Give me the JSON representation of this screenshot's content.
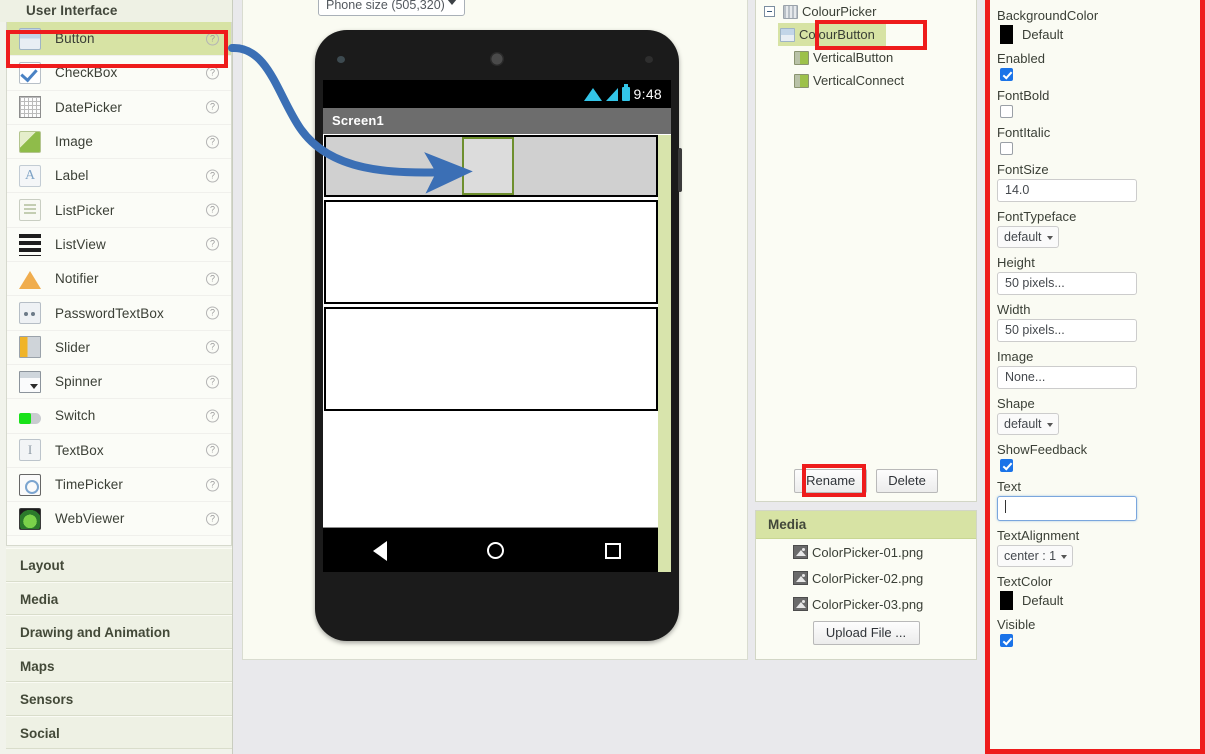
{
  "palette": {
    "header": "User Interface",
    "items": [
      {
        "label": "Button",
        "icon": "button-icon",
        "selected": true,
        "help": "?"
      },
      {
        "label": "CheckBox",
        "icon": "checkbox-icon",
        "selected": false,
        "help": "?"
      },
      {
        "label": "DatePicker",
        "icon": "datepicker-icon",
        "selected": false,
        "help": "?"
      },
      {
        "label": "Image",
        "icon": "image-icon",
        "selected": false,
        "help": "?"
      },
      {
        "label": "Label",
        "icon": "label-icon",
        "selected": false,
        "help": "?"
      },
      {
        "label": "ListPicker",
        "icon": "listpicker-icon",
        "selected": false,
        "help": "?"
      },
      {
        "label": "ListView",
        "icon": "listview-icon",
        "selected": false,
        "help": "?"
      },
      {
        "label": "Notifier",
        "icon": "notifier-icon",
        "selected": false,
        "help": "?"
      },
      {
        "label": "PasswordTextBox",
        "icon": "password-icon",
        "selected": false,
        "help": "?"
      },
      {
        "label": "Slider",
        "icon": "slider-icon",
        "selected": false,
        "help": "?"
      },
      {
        "label": "Spinner",
        "icon": "spinner-icon",
        "selected": false,
        "help": "?"
      },
      {
        "label": "Switch",
        "icon": "switch-icon",
        "selected": false,
        "help": "?"
      },
      {
        "label": "TextBox",
        "icon": "textbox-icon",
        "selected": false,
        "help": "?"
      },
      {
        "label": "TimePicker",
        "icon": "timepicker-icon",
        "selected": false,
        "help": "?"
      },
      {
        "label": "WebViewer",
        "icon": "webviewer-icon",
        "selected": false,
        "help": "?"
      }
    ],
    "categories": [
      "Layout",
      "Media",
      "Drawing and Animation",
      "Maps",
      "Sensors",
      "Social"
    ]
  },
  "viewer": {
    "phone_size_label": "Phone size (505,320)",
    "status_bar_time": "9:48",
    "screen_title": "Screen1",
    "nav_back_icon": "triangle-back-icon",
    "nav_home_icon": "circle-home-icon",
    "nav_recent_icon": "square-recent-icon"
  },
  "components": {
    "tree": [
      {
        "label": "ColourPicker",
        "icon": "screen-icon",
        "indent": 0,
        "selected": false,
        "toggle": true
      },
      {
        "label": "ColourButton",
        "icon": "button-icon",
        "indent": 1,
        "selected": true,
        "toggle": false
      },
      {
        "label": "VerticalButton",
        "icon": "vertical-arrangement-icon",
        "indent": 1,
        "selected": false,
        "toggle": false
      },
      {
        "label": "VerticalConnect",
        "icon": "vertical-arrangement-icon",
        "indent": 1,
        "selected": false,
        "toggle": false
      }
    ],
    "rename_label": "Rename",
    "delete_label": "Delete"
  },
  "media": {
    "header": "Media",
    "files": [
      "ColorPicker-01.png",
      "ColorPicker-02.png",
      "ColorPicker-03.png"
    ],
    "upload_label": "Upload File ..."
  },
  "properties": [
    {
      "name": "BackgroundColor",
      "type": "color",
      "value": "Default",
      "swatch": "#000000"
    },
    {
      "name": "Enabled",
      "type": "checkbox",
      "checked": true
    },
    {
      "name": "FontBold",
      "type": "checkbox",
      "checked": false
    },
    {
      "name": "FontItalic",
      "type": "checkbox",
      "checked": false
    },
    {
      "name": "FontSize",
      "type": "input",
      "value": "14.0"
    },
    {
      "name": "FontTypeface",
      "type": "select",
      "value": "default"
    },
    {
      "name": "Height",
      "type": "input",
      "value": "50 pixels..."
    },
    {
      "name": "Width",
      "type": "input",
      "value": "50 pixels..."
    },
    {
      "name": "Image",
      "type": "input",
      "value": "None..."
    },
    {
      "name": "Shape",
      "type": "select",
      "value": "default"
    },
    {
      "name": "ShowFeedback",
      "type": "checkbox",
      "checked": true
    },
    {
      "name": "Text",
      "type": "input-focused",
      "value": ""
    },
    {
      "name": "TextAlignment",
      "type": "select",
      "value": "center : 1"
    },
    {
      "name": "TextColor",
      "type": "color",
      "value": "Default",
      "swatch": "#000000"
    },
    {
      "name": "Visible",
      "type": "checkbox",
      "checked": true
    }
  ],
  "annotations": {
    "highlight_color": "#ee1c1c",
    "arrow_color": "#3b6fb5",
    "arrow_description": "arrow from Button palette item to selected button on screen"
  }
}
